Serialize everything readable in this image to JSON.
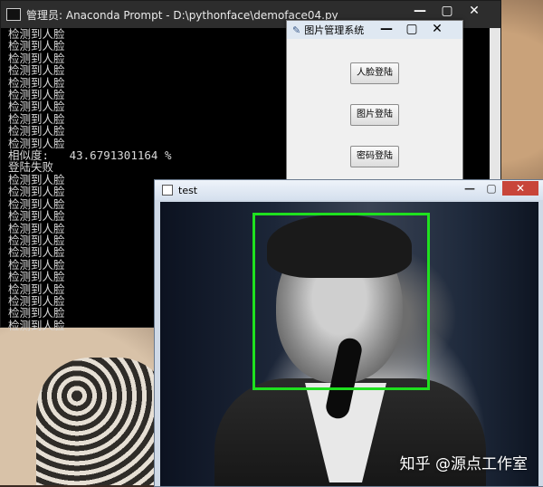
{
  "console": {
    "title": "管理员: Anaconda Prompt - D:\\pythonface\\demoface04.py",
    "lines": [
      "检测到人脸",
      "检测到人脸",
      "检测到人脸",
      "检测到人脸",
      "检测到人脸",
      "检测到人脸",
      "检测到人脸",
      "检测到人脸",
      "检测到人脸",
      "检测到人脸",
      "相似度:   43.6791301164 %",
      "登陆失败",
      "检测到人脸",
      "检测到人脸",
      "检测到人脸",
      "检测到人脸",
      "检测到人脸",
      "检测到人脸",
      "检测到人脸",
      "检测到人脸",
      "检测到人脸",
      "检测到人脸",
      "检测到人脸",
      "检测到人脸",
      "检测到人脸"
    ],
    "controls": {
      "minimize": "—",
      "maximize": "▢",
      "close": "✕"
    }
  },
  "dialog": {
    "title": "图片管理系统",
    "buttons": {
      "face_login": "人脸登陆",
      "image_login": "图片登陆",
      "password_login": "密码登陆"
    },
    "controls": {
      "minimize": "—",
      "maximize": "▢",
      "close": "✕"
    }
  },
  "test_window": {
    "title": "test",
    "controls": {
      "minimize": "—",
      "maximize": "▢",
      "close": "✕"
    },
    "detection_box_color": "#1fe01f"
  },
  "watermark": "知乎 @源点工作室"
}
